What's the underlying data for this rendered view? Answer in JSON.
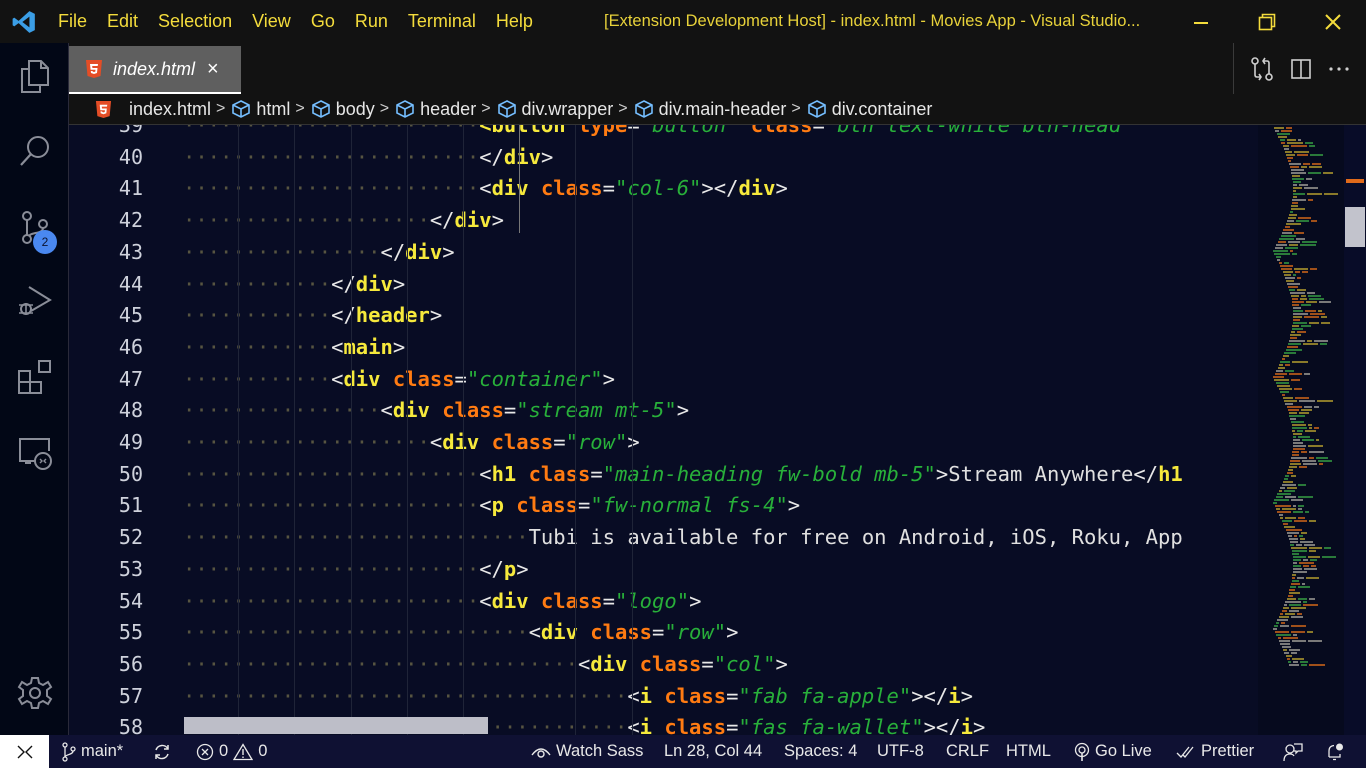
{
  "titlebar": {
    "menu": [
      "File",
      "Edit",
      "Selection",
      "View",
      "Go",
      "Run",
      "Terminal",
      "Help"
    ],
    "title": "[Extension Development Host] - index.html - Movies App - Visual Studio...",
    "controls": [
      "minimize",
      "restore",
      "close"
    ]
  },
  "activity_bar": {
    "items": [
      "explorer",
      "search",
      "source-control",
      "run-and-debug",
      "extensions",
      "remote-explorer"
    ],
    "source_control_badge": "2",
    "bottom": [
      "manage"
    ]
  },
  "tabs": [
    {
      "label": "index.html",
      "icon": "html5-icon",
      "active": true,
      "close": "×"
    }
  ],
  "tab_actions": [
    "open-changes",
    "split-editor",
    "more-actions"
  ],
  "breadcrumb": [
    {
      "label": "index.html",
      "icon": "html5-icon"
    },
    {
      "label": "html",
      "icon": "symbol-cube-icon"
    },
    {
      "label": "body",
      "icon": "symbol-cube-icon"
    },
    {
      "label": "header",
      "icon": "symbol-cube-icon"
    },
    {
      "label": "div.wrapper",
      "icon": "symbol-cube-icon"
    },
    {
      "label": "div.main-header",
      "icon": "symbol-cube-icon"
    },
    {
      "label": "div.container",
      "icon": "symbol-cube-icon"
    }
  ],
  "editor": {
    "lines": [
      {
        "n": "39",
        "indent": 24,
        "tokens": [
          [
            "tg",
            "<button "
          ],
          [
            "at",
            "type"
          ],
          [
            "pn",
            "="
          ],
          [
            "st",
            "\"button\" "
          ],
          [
            "at",
            "class"
          ],
          [
            "pn",
            "="
          ],
          [
            "st",
            "\"btn text-white btn-head"
          ]
        ]
      },
      {
        "n": "40",
        "indent": 24,
        "tokens": [
          [
            "pn",
            "</"
          ],
          [
            "tg",
            "div"
          ],
          [
            "pn",
            ">"
          ]
        ]
      },
      {
        "n": "41",
        "indent": 24,
        "tokens": [
          [
            "pn",
            "<"
          ],
          [
            "tg",
            "div "
          ],
          [
            "at",
            "class"
          ],
          [
            "pn",
            "="
          ],
          [
            "st",
            "\"col-6\""
          ],
          [
            "pn",
            "></"
          ],
          [
            "tg",
            "div"
          ],
          [
            "pn",
            ">"
          ]
        ]
      },
      {
        "n": "42",
        "indent": 20,
        "tokens": [
          [
            "pn",
            "</"
          ],
          [
            "tg",
            "div"
          ],
          [
            "pn",
            ">"
          ]
        ]
      },
      {
        "n": "43",
        "indent": 16,
        "tokens": [
          [
            "pn",
            "</"
          ],
          [
            "tg",
            "div"
          ],
          [
            "pn",
            ">"
          ]
        ]
      },
      {
        "n": "44",
        "indent": 12,
        "tokens": [
          [
            "pn",
            "</"
          ],
          [
            "tg",
            "div"
          ],
          [
            "pn",
            ">"
          ]
        ]
      },
      {
        "n": "45",
        "indent": 12,
        "tokens": [
          [
            "pn",
            "</"
          ],
          [
            "tg",
            "header"
          ],
          [
            "pn",
            ">"
          ]
        ]
      },
      {
        "n": "46",
        "indent": 12,
        "tokens": [
          [
            "pn",
            "<"
          ],
          [
            "tg",
            "main"
          ],
          [
            "pn",
            ">"
          ]
        ]
      },
      {
        "n": "47",
        "indent": 12,
        "tokens": [
          [
            "pn",
            "<"
          ],
          [
            "tg",
            "div "
          ],
          [
            "at",
            "class"
          ],
          [
            "pn",
            "="
          ],
          [
            "st",
            "\"container\""
          ],
          [
            "pn",
            ">"
          ]
        ]
      },
      {
        "n": "48",
        "indent": 16,
        "tokens": [
          [
            "pn",
            "<"
          ],
          [
            "tg",
            "div "
          ],
          [
            "at",
            "class"
          ],
          [
            "pn",
            "="
          ],
          [
            "st",
            "\"stream mt-5\""
          ],
          [
            "pn",
            ">"
          ]
        ]
      },
      {
        "n": "49",
        "indent": 20,
        "tokens": [
          [
            "pn",
            "<"
          ],
          [
            "tg",
            "div "
          ],
          [
            "at",
            "class"
          ],
          [
            "pn",
            "="
          ],
          [
            "st",
            "\"row\""
          ],
          [
            "pn",
            ">"
          ]
        ]
      },
      {
        "n": "50",
        "indent": 24,
        "tokens": [
          [
            "pn",
            "<"
          ],
          [
            "tg",
            "h1 "
          ],
          [
            "at",
            "class"
          ],
          [
            "pn",
            "="
          ],
          [
            "st",
            "\"main-heading fw-bold mb-5\""
          ],
          [
            "pn",
            ">"
          ],
          [
            "tx",
            "Stream Anywhere"
          ],
          [
            "pn",
            "</"
          ],
          [
            "tg",
            "h1"
          ]
        ]
      },
      {
        "n": "51",
        "indent": 24,
        "tokens": [
          [
            "pn",
            "<"
          ],
          [
            "tg",
            "p "
          ],
          [
            "at",
            "class"
          ],
          [
            "pn",
            "="
          ],
          [
            "st",
            "\"fw-normal fs-4\""
          ],
          [
            "pn",
            ">"
          ]
        ]
      },
      {
        "n": "52",
        "indent": 28,
        "tokens": [
          [
            "tx",
            "Tubi is available for free on Android, iOS, Roku, App"
          ]
        ]
      },
      {
        "n": "53",
        "indent": 24,
        "tokens": [
          [
            "pn",
            "</"
          ],
          [
            "tg",
            "p"
          ],
          [
            "pn",
            ">"
          ]
        ]
      },
      {
        "n": "54",
        "indent": 24,
        "tokens": [
          [
            "pn",
            "<"
          ],
          [
            "tg",
            "div "
          ],
          [
            "at",
            "class"
          ],
          [
            "pn",
            "="
          ],
          [
            "st",
            "\"logo\""
          ],
          [
            "pn",
            ">"
          ]
        ]
      },
      {
        "n": "55",
        "indent": 28,
        "tokens": [
          [
            "pn",
            "<"
          ],
          [
            "tg",
            "div "
          ],
          [
            "at",
            "class"
          ],
          [
            "pn",
            "="
          ],
          [
            "st",
            "\"row\""
          ],
          [
            "pn",
            ">"
          ]
        ]
      },
      {
        "n": "56",
        "indent": 32,
        "tokens": [
          [
            "pn",
            "<"
          ],
          [
            "tg",
            "div "
          ],
          [
            "at",
            "class"
          ],
          [
            "pn",
            "="
          ],
          [
            "st",
            "\"col\""
          ],
          [
            "pn",
            ">"
          ]
        ]
      },
      {
        "n": "57",
        "indent": 36,
        "tokens": [
          [
            "pn",
            "<"
          ],
          [
            "tg",
            "i "
          ],
          [
            "at",
            "class"
          ],
          [
            "pn",
            "="
          ],
          [
            "st",
            "\"fab fa-apple\""
          ],
          [
            "pn",
            "></"
          ],
          [
            "tg",
            "i"
          ],
          [
            "pn",
            ">"
          ]
        ]
      },
      {
        "n": "58",
        "indent": 36,
        "tokens": [
          [
            "pn",
            "<"
          ],
          [
            "tg",
            "i "
          ],
          [
            "at",
            "class"
          ],
          [
            "pn",
            "="
          ],
          [
            "st",
            "\"fas fa-wallet\""
          ],
          [
            "pn",
            "></"
          ],
          [
            "tg",
            "i"
          ],
          [
            "pn",
            ">"
          ]
        ]
      }
    ]
  },
  "statusbar": {
    "branch": "main*",
    "errors": "0",
    "warnings": "0",
    "watch_sass": "Watch Sass",
    "cursor": "Ln 28, Col 44",
    "spaces": "Spaces: 4",
    "encoding": "UTF-8",
    "eol": "CRLF",
    "language": "HTML",
    "go_live": "Go Live",
    "prettier": "Prettier"
  }
}
